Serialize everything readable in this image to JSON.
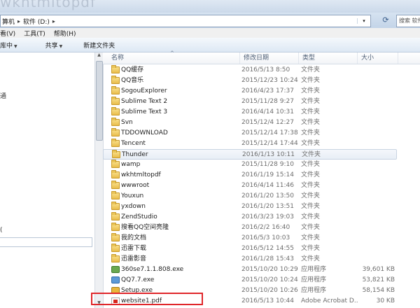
{
  "titlebar": {
    "ghost_title": "wkhtmltopdf"
  },
  "address": {
    "crumbs": [
      "算机",
      "软件 (D:)"
    ],
    "search_placeholder": "搜索 软件 (D:)"
  },
  "menu": [
    "看(V)",
    "工具(T)",
    "帮助(H)"
  ],
  "toolbar": {
    "organize": "库中",
    "share": "共享",
    "new_folder": "新建文件夹"
  },
  "nav": {
    "glyph_a": "通",
    "glyph_b": "("
  },
  "columns": {
    "name": "名称",
    "date": "修改日期",
    "type": "类型",
    "size": "大小"
  },
  "files": [
    {
      "name": "QQ缓存",
      "date": "2016/5/13 8:50",
      "type": "文件夹",
      "size": "",
      "icon": "folder-icon"
    },
    {
      "name": "QQ音乐",
      "date": "2015/12/23 10:24",
      "type": "文件夹",
      "size": "",
      "icon": "folder-icon"
    },
    {
      "name": "SogouExplorer",
      "date": "2016/4/23 17:37",
      "type": "文件夹",
      "size": "",
      "icon": "folder-icon"
    },
    {
      "name": "Sublime Text 2",
      "date": "2015/11/28 9:27",
      "type": "文件夹",
      "size": "",
      "icon": "folder-icon"
    },
    {
      "name": "Sublime Text 3",
      "date": "2016/4/14 10:31",
      "type": "文件夹",
      "size": "",
      "icon": "folder-icon"
    },
    {
      "name": "Svn",
      "date": "2015/12/4 12:27",
      "type": "文件夹",
      "size": "",
      "icon": "folder-icon"
    },
    {
      "name": "TDDOWNLOAD",
      "date": "2015/12/14 17:38",
      "type": "文件夹",
      "size": "",
      "icon": "folder-icon"
    },
    {
      "name": "Tencent",
      "date": "2015/12/14 17:44",
      "type": "文件夹",
      "size": "",
      "icon": "folder-icon"
    },
    {
      "name": "Thunder",
      "date": "2016/1/13 10:11",
      "type": "文件夹",
      "size": "",
      "icon": "folder-icon",
      "selected": true
    },
    {
      "name": "wamp",
      "date": "2015/11/28 9:10",
      "type": "文件夹",
      "size": "",
      "icon": "folder-icon"
    },
    {
      "name": "wkhtmltopdf",
      "date": "2016/1/19 15:14",
      "type": "文件夹",
      "size": "",
      "icon": "folder-icon"
    },
    {
      "name": "wwwroot",
      "date": "2016/4/14 11:46",
      "type": "文件夹",
      "size": "",
      "icon": "folder-icon"
    },
    {
      "name": "Youxun",
      "date": "2016/1/20 13:50",
      "type": "文件夹",
      "size": "",
      "icon": "folder-icon"
    },
    {
      "name": "yxdown",
      "date": "2016/1/20 13:51",
      "type": "文件夹",
      "size": "",
      "icon": "folder-icon"
    },
    {
      "name": "ZendStudio",
      "date": "2016/3/23 19:03",
      "type": "文件夹",
      "size": "",
      "icon": "folder-icon"
    },
    {
      "name": "搜看QQ空间亮隆",
      "date": "2016/2/2 16:40",
      "type": "文件夹",
      "size": "",
      "icon": "folder-icon"
    },
    {
      "name": "我的文档",
      "date": "2016/5/3 10:03",
      "type": "文件夹",
      "size": "",
      "icon": "folder-icon"
    },
    {
      "name": "迅雷下载",
      "date": "2016/5/12 14:55",
      "type": "文件夹",
      "size": "",
      "icon": "folder-icon"
    },
    {
      "name": "迅雷影音",
      "date": "2016/1/28 15:43",
      "type": "文件夹",
      "size": "",
      "icon": "folder-icon"
    },
    {
      "name": "360se7.1.1.808.exe",
      "date": "2015/10/20 10:29",
      "type": "应用程序",
      "size": "39,601 KB",
      "icon": "exe-icon"
    },
    {
      "name": "QQ7.7.exe",
      "date": "2015/10/20 10:24",
      "type": "应用程序",
      "size": "53,821 KB",
      "icon": "exe-icon qq"
    },
    {
      "name": "Setup.exe",
      "date": "2015/10/20 10:26",
      "type": "应用程序",
      "size": "58,154 KB",
      "icon": "exe-icon setup"
    },
    {
      "name": "website1.pdf",
      "date": "2016/5/13 10:44",
      "type": "Adobe Acrobat D...",
      "size": "30 KB",
      "icon": "pdf-icon"
    }
  ]
}
